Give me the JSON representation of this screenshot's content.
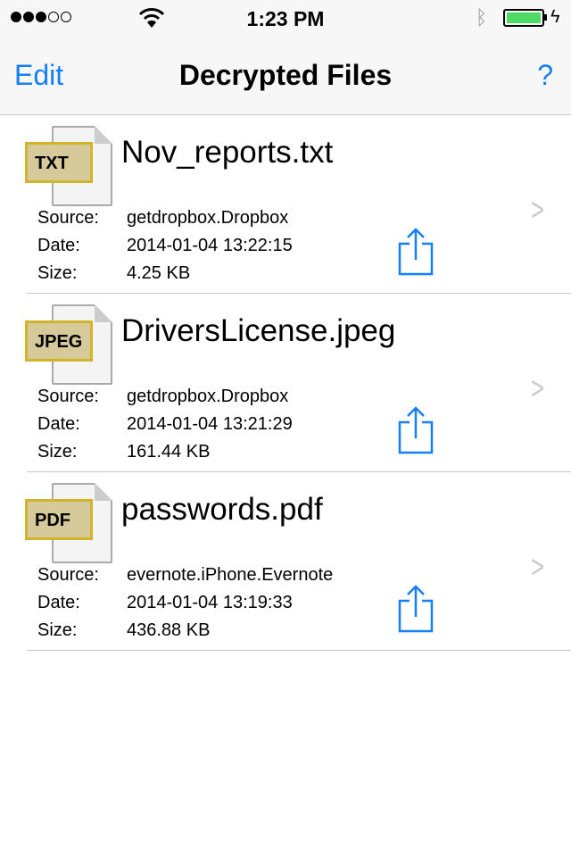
{
  "status": {
    "time": "1:23 PM",
    "signal_bars": 3,
    "signal_total": 5,
    "battery_percent": 100,
    "bluetooth": "bluetooth-icon",
    "charging": "bolt-icon"
  },
  "nav": {
    "edit": "Edit",
    "title": "Decrypted Files",
    "help": "?"
  },
  "labels": {
    "source": "Source:",
    "date": "Date:",
    "size": "Size:"
  },
  "files": [
    {
      "type": "TXT",
      "name": "Nov_reports.txt",
      "source": "getdropbox.Dropbox",
      "date": "2014-01-04 13:22:15",
      "size": "4.25 KB"
    },
    {
      "type": "JPEG",
      "name": "DriversLicense.jpeg",
      "source": "getdropbox.Dropbox",
      "date": "2014-01-04 13:21:29",
      "size": "161.44 KB"
    },
    {
      "type": "PDF",
      "name": "passwords.pdf",
      "source": "evernote.iPhone.Evernote",
      "date": "2014-01-04 13:19:33",
      "size": "436.88 KB"
    }
  ],
  "colors": {
    "accent": "#147efb",
    "battery": "#4cd964"
  }
}
